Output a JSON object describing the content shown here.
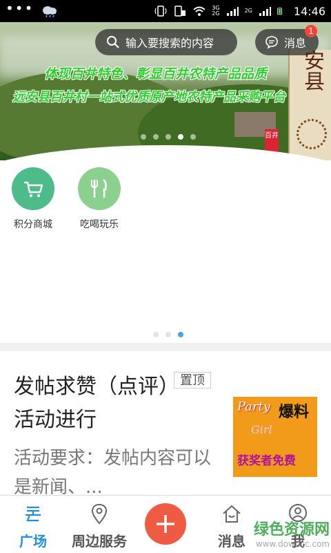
{
  "status_bar": {
    "dots": "•••",
    "network_top": "3G",
    "network_bottom": "2G",
    "network_extra": "2G",
    "time": "14:46"
  },
  "banner": {
    "slogan_line1": "体现百井特色、彰显百井农特产品品质",
    "slogan_line2": "远安县百井村一站式优质原产地农特产品采购平台",
    "side_text": "安县",
    "tag_text": "百井",
    "slide_count": 5,
    "active_slide": 3
  },
  "search": {
    "placeholder": "输入要搜索的内容"
  },
  "messages": {
    "label": "消息",
    "badge_count": "1"
  },
  "quick_entries": [
    {
      "label": "积分商城",
      "icon": "cart-icon",
      "color": "#4dbb8a"
    },
    {
      "label": "吃喝玩乐",
      "icon": "fork-knife-icon",
      "color": "#8bd08e"
    }
  ],
  "page_indicator": {
    "count": 3,
    "active": 2
  },
  "article": {
    "title": "发帖求赞（点评）活动进行",
    "pin_label": "置顶",
    "summary": "活动要求：发帖内容可以是新闻、...",
    "thumbnail": {
      "text1": "Party",
      "text2": "爆料",
      "text3": "Girl",
      "text4": "获奖者免费"
    }
  },
  "bottom_nav": {
    "items": [
      {
        "label": "广场",
        "icon": "plaza-icon",
        "active": true
      },
      {
        "label": "周边服务",
        "icon": "location-pin-icon",
        "active": false
      },
      {
        "label": "消息",
        "icon": "home-message-icon",
        "active": false
      },
      {
        "label": "我",
        "icon": "user-icon",
        "active": false
      }
    ],
    "add_icon": "plus-icon"
  },
  "watermark": {
    "line1": "绿色资源网",
    "line2": "www.downcc.com"
  },
  "colors": {
    "accent": "#1e8fe0",
    "add_button": "#ef5a42",
    "badge": "#f04438"
  }
}
